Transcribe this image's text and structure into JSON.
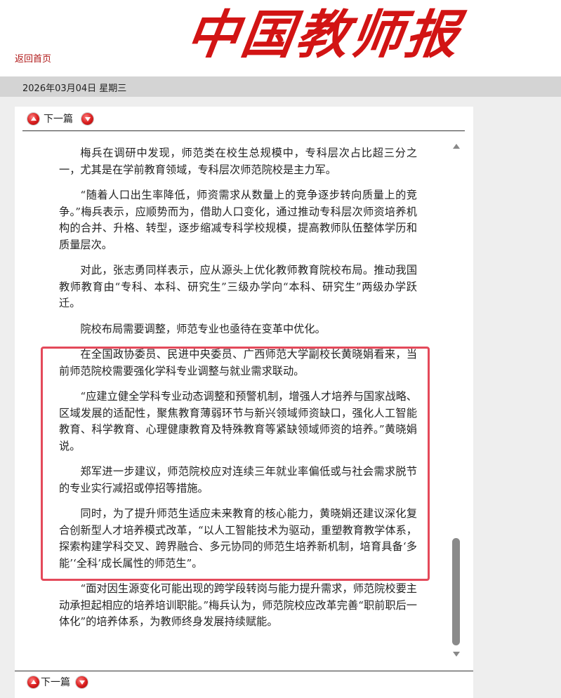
{
  "header": {
    "back_link": "返回首页",
    "logo_text": "中国教师报"
  },
  "datebar": {
    "date": "2026年03月04日  星期三"
  },
  "nav": {
    "top_label": "下一篇",
    "bottom_label": "下一篇"
  },
  "article": {
    "paragraphs": [
      "梅兵在调研中发现，师范类在校生总规模中，专科层次占比超三分之一，尤其是在学前教育领域，专科层次师范院校是主力军。",
      "“随着人口出生率降低，师资需求从数量上的竞争逐步转向质量上的竞争。”梅兵表示，应顺势而为，借助人口变化，通过推动专科层次师资培养机构的合并、升格、转型，逐步缩减专科学校规模，提高教师队伍整体学历和质量层次。",
      "对此，张志勇同样表示，应从源头上优化教师教育院校布局。推动我国教师教育由“专科、本科、研究生”三级办学向“本科、研究生”两级办学跃迁。",
      "院校布局需要调整，师范专业也亟待在变革中优化。",
      "在全国政协委员、民进中央委员、广西师范大学副校长黄晓娟看来，当前师范院校需要强化学科专业调整与就业需求联动。",
      "“应建立健全学科专业动态调整和预警机制，增强人才培养与国家战略、区域发展的适配性，聚焦教育薄弱环节与新兴领域师资缺口，强化人工智能教育、科学教育、心理健康教育及特殊教育等紧缺领域师资的培养。”黄晓娟说。",
      "郑军进一步建议，师范院校应对连续三年就业率偏低或与社会需求脱节的专业实行减招或停招等措施。",
      "同时，为了提升师范生适应未来教育的核心能力，黄晓娟还建议深化复合创新型人才培养模式改革，“以人工智能技术为驱动，重塑教育教学体系，探索构建学科交叉、跨界融合、多元协同的师范生培养新机制，培育具备‘多能’‘全科’成长属性的师范生”。",
      "“面对因生源变化可能出现的跨学段转岗与能力提升需求，师范院校要主动承担起相应的培养培训职能。”梅兵认为，师范院校应改革完善“职前职后一体化”的培养体系，为教师终身发展持续赋能。"
    ]
  },
  "colors": {
    "logo_red": "#d21414",
    "link_red": "#b01818",
    "highlight_border": "#e4495a",
    "datebar_bg": "#d4d4d4"
  },
  "icons": {
    "nav_prev": "red-up-arrow-icon",
    "nav_next": "red-down-arrow-icon",
    "scroll_up": "scroll-up-arrow-icon",
    "scroll_down": "scroll-down-arrow-icon"
  }
}
